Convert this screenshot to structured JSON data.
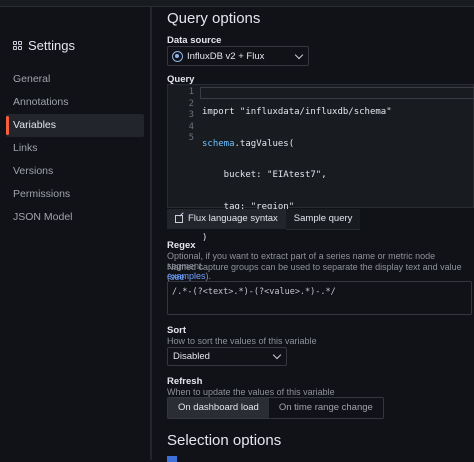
{
  "sidebar": {
    "title": "Settings",
    "items": [
      {
        "label": "General"
      },
      {
        "label": "Annotations"
      },
      {
        "label": "Variables",
        "active": true
      },
      {
        "label": "Links"
      },
      {
        "label": "Versions"
      },
      {
        "label": "Permissions"
      },
      {
        "label": "JSON Model"
      }
    ]
  },
  "query_options": {
    "title": "Query options",
    "data_source_label": "Data source",
    "data_source_value": "InfluxDB v2 + Flux",
    "query_label": "Query",
    "line_numbers": [
      "1",
      "2",
      "3",
      "4",
      "5"
    ],
    "code_lines": [
      "import \"influxdata/influxdb/schema\"",
      "schema.tagValues(",
      "    bucket: \"EIAtest7\",",
      "    tag: \"region\"",
      ")"
    ],
    "tabs": [
      "Flux language syntax",
      "Sample query"
    ],
    "regex_label": "Regex",
    "regex_desc_1": "Optional, if you want to extract part of a series name or metric node segment.",
    "regex_desc_2": "Named capture groups can be used to separate the display text and value (",
    "regex_desc_link": "see",
    "regex_desc_3_link": "examples",
    "regex_desc_3_tail": ").",
    "regex_value": "/.*-(?<text>.*)-(?<value>.*)-.*/",
    "sort_label": "Sort",
    "sort_desc": "How to sort the values of this variable",
    "sort_value": "Disabled",
    "refresh_label": "Refresh",
    "refresh_desc": "When to update the values of this variable",
    "refresh_options": [
      "On dashboard load",
      "On time range change"
    ]
  },
  "selection_options": {
    "title": "Selection options"
  },
  "colors": {
    "accent": "#f55f3e",
    "link": "#6e9fff",
    "background": "#111217"
  }
}
